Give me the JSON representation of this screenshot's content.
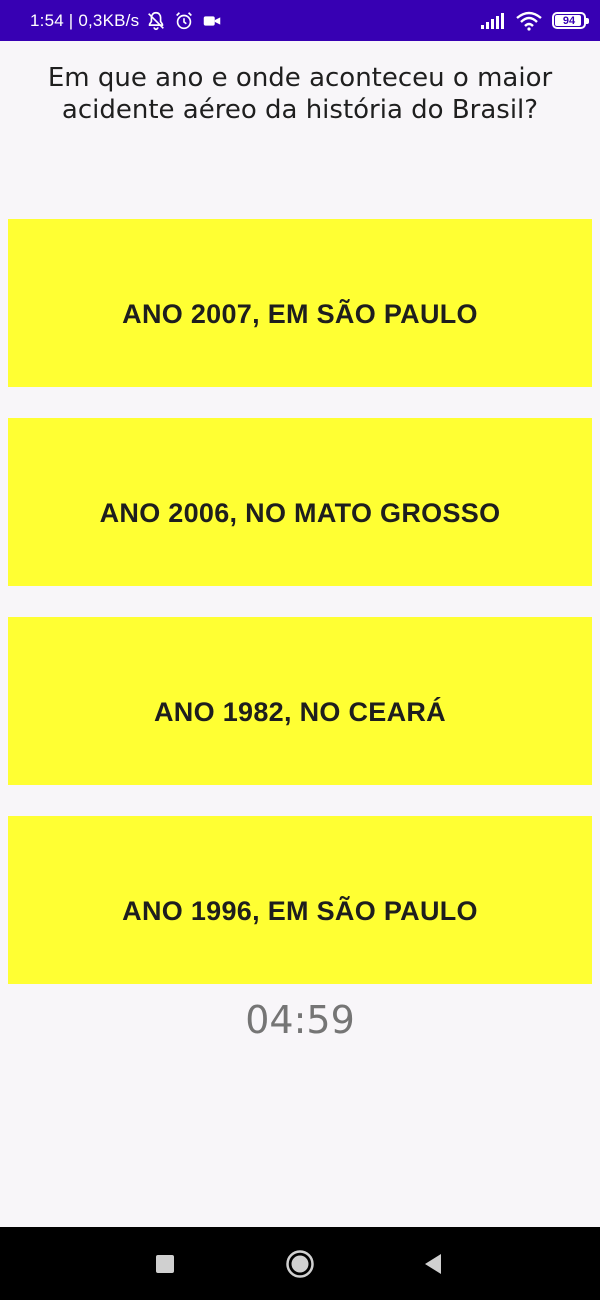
{
  "status_bar": {
    "time_and_speed": "1:54 | 0,3KB/s",
    "battery_level": 94,
    "battery_text": "94",
    "background_color": "#3700b3",
    "icons": [
      "bell-off-icon",
      "alarm-icon",
      "video-camera-icon",
      "signal-icon",
      "wifi-icon",
      "battery-icon"
    ]
  },
  "question": {
    "text": "Em que ano e onde aconteceu o maior acidente aéreo da história do Brasil?"
  },
  "answers": [
    {
      "label": "ANO 2007, EM SÃO PAULO"
    },
    {
      "label": "ANO 2006, NO MATO GROSSO"
    },
    {
      "label": "ANO 1982, NO CEARÁ"
    },
    {
      "label": "ANO 1996, EM SÃO PAULO"
    }
  ],
  "answer_color": "#ffff33",
  "timer": {
    "text": "04:59"
  },
  "nav_bar": {
    "icons": [
      "recents-square-icon",
      "home-circle-icon",
      "back-triangle-icon"
    ]
  }
}
